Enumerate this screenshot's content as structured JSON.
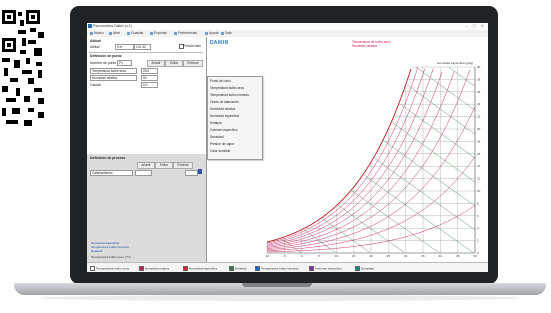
{
  "window": {
    "title": "Psicrometria Daikin (v.1)",
    "controls": "–  ▢  ✕"
  },
  "toolbar": [
    {
      "label": "Nuevo"
    },
    {
      "label": "Abrir"
    },
    {
      "label": "Guardar"
    },
    {
      "label": "Exportar"
    },
    {
      "label": "Preferencias"
    },
    {
      "label": "Ayuda"
    },
    {
      "label": "Salir"
    }
  ],
  "left_panel": {
    "section1_title": "Altitud",
    "altitude_label": "Altitud",
    "altitude_value": "0 m",
    "altitude_unit": "101.32",
    "pressure_check_label": "Presión atm",
    "section2_title": "Definición de punto",
    "point_label": "Nombre de punto",
    "point_value": "P1",
    "btn_add": "Añadir",
    "btn_edit": "Editar",
    "btn_delete": "Eliminar",
    "var1_select": "Temperatura bulbo seco",
    "var1_value": "25.0",
    "var2_select": "Humedad relativa",
    "var2_value": "50",
    "var3_label": "Caudal",
    "var3_value": "0.0",
    "section3_title": "Definición de proceso",
    "proc_btn1": "Añadir",
    "proc_btn2": "Editar",
    "proc_btn3": "Eliminar",
    "proc_select": "Calentamiento",
    "status_line1": "Humedad específica",
    "status_line2": "Temperatura bulbo húmedo",
    "status_line3": "Entalpía"
  },
  "chart_header": {
    "brand": "DAIKIN",
    "title_line1": "Temperatura de bulbo seco",
    "title_line2": "Humedad relativa"
  },
  "dropdown": {
    "items": [
      "Punto de rocío",
      "Temperatura bulbo seco",
      "Temperatura bulbo húmedo",
      "Grado de saturación",
      "Humedad relativa",
      "Humedad específica",
      "Entalpía",
      "Volumen específico",
      "Densidad",
      "Presión de vapor",
      "Calor sensible"
    ]
  },
  "legend": [
    {
      "label": "Temperatura bulbo seco",
      "color": "#ffffff"
    },
    {
      "label": "Humedad relativa",
      "color": "#c2185b"
    },
    {
      "label": "Humedad específica",
      "color": "#c62828"
    },
    {
      "label": "Entalpía",
      "color": "#2e7d32"
    },
    {
      "label": "Temperatura bulbo húmedo",
      "color": "#1565c0"
    },
    {
      "label": "Volumen específico",
      "color": "#8e24aa"
    },
    {
      "label": "Densidad",
      "color": "#00897b"
    }
  ],
  "axes": {
    "x_label": "Temperatura bulbo seco (°C)",
    "y_label": "Humedad específica (g/kg)",
    "x_ticks": [
      "-10",
      "-5",
      "0",
      "5",
      "10",
      "15",
      "20",
      "25",
      "30",
      "35",
      "40",
      "45",
      "50"
    ],
    "y_ticks": [
      "0",
      "2",
      "4",
      "6",
      "8",
      "10",
      "12",
      "14",
      "16",
      "18",
      "20",
      "22",
      "24",
      "26",
      "28",
      "30"
    ]
  },
  "colors": {
    "rh": "#c2185b",
    "enthalpy": "#2e7d32",
    "sat": "#b71c1c",
    "grid": "#9a9a9a"
  }
}
